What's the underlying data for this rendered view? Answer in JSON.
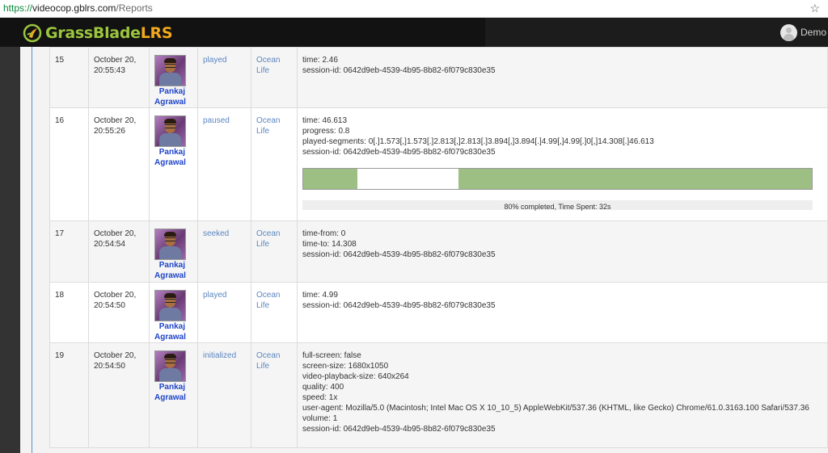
{
  "browser": {
    "url_scheme": "https://",
    "url_host": "videocop.gblrs.com",
    "url_path": "/Reports"
  },
  "header": {
    "logo_part1": "GrassBlade",
    "logo_part2": "LRS",
    "user_name": "Demo"
  },
  "rows": [
    {
      "num": "15",
      "date_line1": "October 20,",
      "date_line2": "20:55:43",
      "actor_first": "Pankaj",
      "actor_last": "Agrawal",
      "verb": "played",
      "object_line1": "Ocean",
      "object_line2": "Life",
      "details": [
        "time: 2.46",
        "session-id: 0642d9eb-4539-4b95-8b82-6f079c830e35"
      ]
    },
    {
      "num": "16",
      "date_line1": "October 20,",
      "date_line2": "20:55:26",
      "actor_first": "Pankaj",
      "actor_last": "Agrawal",
      "verb": "paused",
      "object_line1": "Ocean",
      "object_line2": "Life",
      "details": [
        "time: 46.613",
        "progress: 0.8",
        "played-segments: 0[.]1.573[,]1.573[.]2.813[,]2.813[.]3.894[,]3.894[.]4.99[,]4.99[.]0[,]14.308[.]46.613",
        "session-id: 0642d9eb-4539-4b95-8b82-6f079c830e35"
      ],
      "progress": {
        "completed_fraction": 0.8,
        "played_ranges": [
          [
            0,
            0.106
          ],
          [
            0.306,
            1.0
          ]
        ],
        "label": "80% completed, Time Spent: 32s",
        "color": "#9ebf84"
      }
    },
    {
      "num": "17",
      "date_line1": "October 20,",
      "date_line2": "20:54:54",
      "actor_first": "Pankaj",
      "actor_last": "Agrawal",
      "verb": "seeked",
      "object_line1": "Ocean",
      "object_line2": "Life",
      "details": [
        "time-from: 0",
        "time-to: 14.308",
        "session-id: 0642d9eb-4539-4b95-8b82-6f079c830e35"
      ]
    },
    {
      "num": "18",
      "date_line1": "October 20,",
      "date_line2": "20:54:50",
      "actor_first": "Pankaj",
      "actor_last": "Agrawal",
      "verb": "played",
      "object_line1": "Ocean",
      "object_line2": "Life",
      "details": [
        "time: 4.99",
        "session-id: 0642d9eb-4539-4b95-8b82-6f079c830e35"
      ]
    },
    {
      "num": "19",
      "date_line1": "October 20,",
      "date_line2": "20:54:50",
      "actor_first": "Pankaj",
      "actor_last": "Agrawal",
      "verb": "initialized",
      "object_line1": "Ocean",
      "object_line2": "Life",
      "details": [
        "full-screen: false",
        "screen-size: 1680x1050",
        "video-playback-size: 640x264",
        "quality: 400",
        "speed: 1x",
        "user-agent: Mozilla/5.0 (Macintosh; Intel Mac OS X 10_10_5) AppleWebKit/537.36 (KHTML, like Gecko) Chrome/61.0.3163.100 Safari/537.36",
        "volume: 1",
        "session-id: 0642d9eb-4539-4b95-8b82-6f079c830e35"
      ]
    }
  ]
}
